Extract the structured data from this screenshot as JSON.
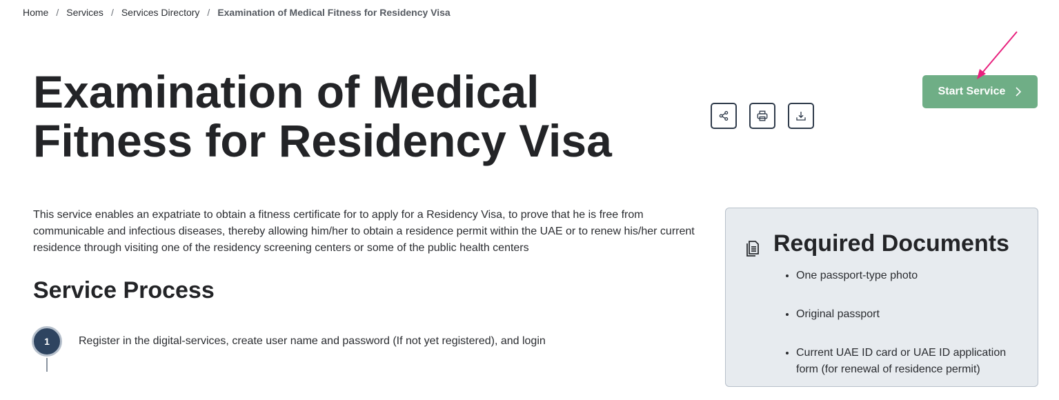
{
  "breadcrumb": {
    "items": [
      "Home",
      "Services",
      "Services Directory"
    ],
    "current": "Examination of Medical Fitness for Residency Visa",
    "separator": "/"
  },
  "page": {
    "title": "Examination of Medical Fitness for Residency Visa",
    "start_button": "Start Service",
    "description": "This service enables an expatriate to obtain a fitness certificate for to apply for a Residency Visa, to prove that he is free from communicable and infectious diseases, thereby allowing him/her to obtain a residence permit within the UAE or to renew his/her current residence through visiting one of the residency screening centers or some of the public health centers"
  },
  "actions": [
    "share-icon",
    "print-icon",
    "download-icon"
  ],
  "process": {
    "title": "Service Process",
    "steps": [
      {
        "number": "1",
        "text": "Register in the digital-services, create user name and password (If not yet registered), and login"
      }
    ]
  },
  "required_documents": {
    "title": "Required Documents",
    "items": [
      "One passport-type photo",
      "Original passport",
      "Current UAE ID card or UAE ID application form (for renewal of residence permit)"
    ]
  },
  "colors": {
    "accent": "#6fae86",
    "annotation_arrow": "#e8207d",
    "step_badge": "#2e4460",
    "panel_bg": "#e7ebef"
  }
}
